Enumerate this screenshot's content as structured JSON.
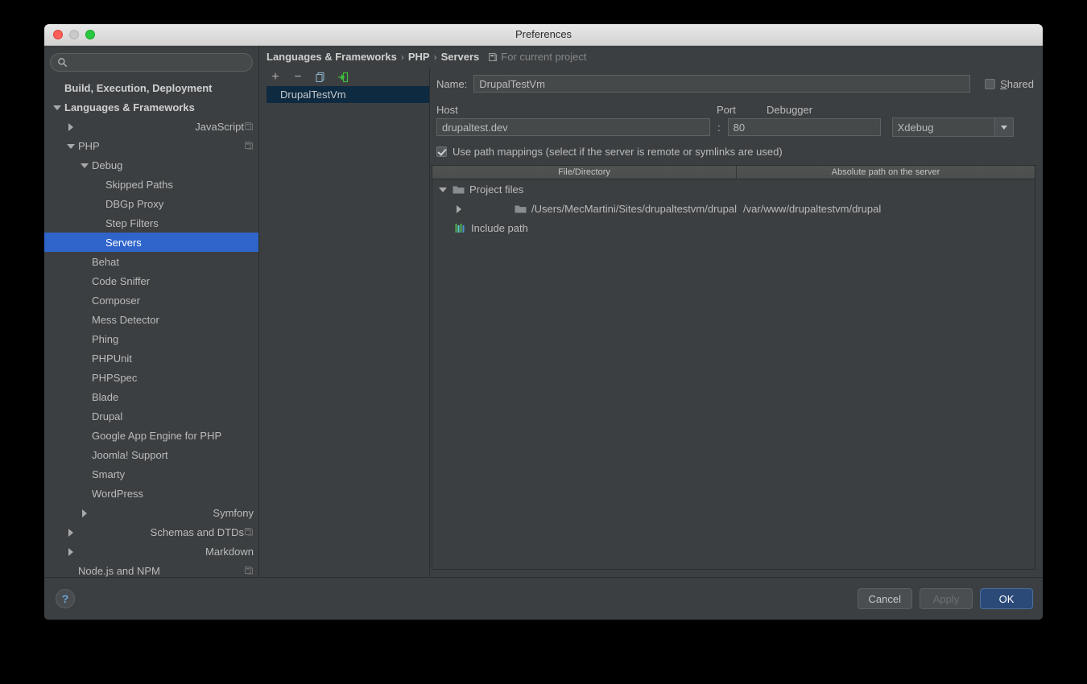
{
  "window": {
    "title": "Preferences",
    "traffic": {
      "close": "close-button",
      "minimize": "minimize-button",
      "maximize": "maximize-button"
    }
  },
  "sidebar": {
    "search": {
      "value": "",
      "placeholder": ""
    },
    "items": [
      {
        "label": "Build, Execution, Deployment",
        "indent": 0,
        "arrow": "none",
        "bold": true,
        "selected": false,
        "badge": false
      },
      {
        "label": "Languages & Frameworks",
        "indent": 0,
        "arrow": "down",
        "bold": true,
        "selected": false,
        "badge": false
      },
      {
        "label": "JavaScript",
        "indent": 1,
        "arrow": "right",
        "bold": false,
        "selected": false,
        "badge": true
      },
      {
        "label": "PHP",
        "indent": 1,
        "arrow": "down",
        "bold": false,
        "selected": false,
        "badge": true
      },
      {
        "label": "Debug",
        "indent": 2,
        "arrow": "down",
        "bold": false,
        "selected": false,
        "badge": false
      },
      {
        "label": "Skipped Paths",
        "indent": 3,
        "arrow": "none",
        "bold": false,
        "selected": false,
        "badge": false
      },
      {
        "label": "DBGp Proxy",
        "indent": 3,
        "arrow": "none",
        "bold": false,
        "selected": false,
        "badge": false
      },
      {
        "label": "Step Filters",
        "indent": 3,
        "arrow": "none",
        "bold": false,
        "selected": false,
        "badge": false
      },
      {
        "label": "Servers",
        "indent": 3,
        "arrow": "none",
        "bold": false,
        "selected": true,
        "badge": false
      },
      {
        "label": "Behat",
        "indent": 2,
        "arrow": "none",
        "bold": false,
        "selected": false,
        "badge": false
      },
      {
        "label": "Code Sniffer",
        "indent": 2,
        "arrow": "none",
        "bold": false,
        "selected": false,
        "badge": false
      },
      {
        "label": "Composer",
        "indent": 2,
        "arrow": "none",
        "bold": false,
        "selected": false,
        "badge": false
      },
      {
        "label": "Mess Detector",
        "indent": 2,
        "arrow": "none",
        "bold": false,
        "selected": false,
        "badge": false
      },
      {
        "label": "Phing",
        "indent": 2,
        "arrow": "none",
        "bold": false,
        "selected": false,
        "badge": false
      },
      {
        "label": "PHPUnit",
        "indent": 2,
        "arrow": "none",
        "bold": false,
        "selected": false,
        "badge": false
      },
      {
        "label": "PHPSpec",
        "indent": 2,
        "arrow": "none",
        "bold": false,
        "selected": false,
        "badge": false
      },
      {
        "label": "Blade",
        "indent": 2,
        "arrow": "none",
        "bold": false,
        "selected": false,
        "badge": false
      },
      {
        "label": "Drupal",
        "indent": 2,
        "arrow": "none",
        "bold": false,
        "selected": false,
        "badge": false
      },
      {
        "label": "Google App Engine for PHP",
        "indent": 2,
        "arrow": "none",
        "bold": false,
        "selected": false,
        "badge": false
      },
      {
        "label": "Joomla! Support",
        "indent": 2,
        "arrow": "none",
        "bold": false,
        "selected": false,
        "badge": false
      },
      {
        "label": "Smarty",
        "indent": 2,
        "arrow": "none",
        "bold": false,
        "selected": false,
        "badge": false
      },
      {
        "label": "WordPress",
        "indent": 2,
        "arrow": "none",
        "bold": false,
        "selected": false,
        "badge": false
      },
      {
        "label": "Symfony",
        "indent": 2,
        "arrow": "right",
        "bold": false,
        "selected": false,
        "badge": false
      },
      {
        "label": "Schemas and DTDs",
        "indent": 1,
        "arrow": "right",
        "bold": false,
        "selected": false,
        "badge": true
      },
      {
        "label": "Markdown",
        "indent": 1,
        "arrow": "right",
        "bold": false,
        "selected": false,
        "badge": false
      },
      {
        "label": "Node.js and NPM",
        "indent": 1,
        "arrow": "none",
        "bold": false,
        "selected": false,
        "badge": true
      }
    ]
  },
  "breadcrumb": {
    "crumbs": [
      "Languages & Frameworks",
      "PHP",
      "Servers"
    ],
    "separator": "›",
    "scope_label": "For current project"
  },
  "server_list": {
    "toolbar": [
      {
        "name": "add-server-button",
        "glyph": "+"
      },
      {
        "name": "remove-server-button",
        "glyph": "−"
      },
      {
        "name": "copy-server-button",
        "glyph": "copy"
      },
      {
        "name": "import-server-button",
        "glyph": "import"
      }
    ],
    "items": [
      {
        "label": "DrupalTestVm",
        "selected": true
      }
    ]
  },
  "detail": {
    "name_label": "Name:",
    "name_value": "DrupalTestVm",
    "name_placeholder": "",
    "shared_label_prefix": "S",
    "shared_label_rest": "hared",
    "shared_checked": false,
    "host_label": "Host",
    "host_value": "drupaltest.dev",
    "host_placeholder": "",
    "colon": ":",
    "port_label": "Port",
    "port_value": "80",
    "port_placeholder": "",
    "debugger_label": "Debugger",
    "debugger_value": "Xdebug",
    "path_mappings_checked": true,
    "path_mappings_label": "Use path mappings (select if the server is remote or symlinks are used)"
  },
  "mapping_table": {
    "columns": [
      "File/Directory",
      "Absolute path on the server"
    ],
    "rows": [
      {
        "file": "Project files",
        "server": "",
        "indent": 0,
        "arrow": "down",
        "icon": "folder-icon"
      },
      {
        "file": "/Users/MecMartini/Sites/drupaltestvm/drupal",
        "server": "/var/www/drupaltestvm/drupal",
        "indent": 1,
        "arrow": "right",
        "icon": "folder-icon"
      },
      {
        "file": "Include path",
        "server": "",
        "indent": 0,
        "arrow": "none",
        "icon": "include-path-icon"
      }
    ]
  },
  "footer": {
    "help": "?",
    "cancel": "Cancel",
    "apply": "Apply",
    "ok": "OK",
    "apply_disabled": true
  },
  "colors": {
    "window_bg": "#3c3f41",
    "selection_blue": "#2f65ca",
    "list_selection": "#0d2a41",
    "default_button": "#2b4a78",
    "text": "#bbbbbb",
    "accent_green": "#3cbe3c",
    "help_blue": "#6ba5d8"
  }
}
